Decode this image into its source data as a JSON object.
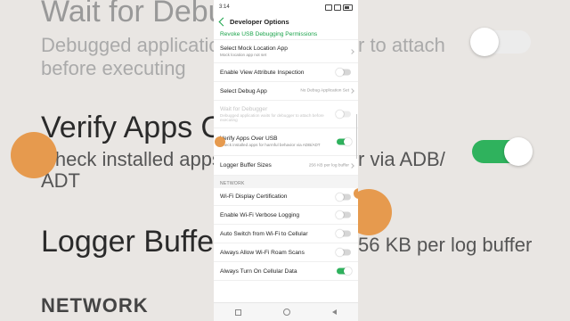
{
  "background": {
    "left": {
      "wait_for_debugger": "Wait for Debugger",
      "debugged_desc_line1": "Debugged application",
      "debugged_desc_line2": "before executing",
      "verify_title": "Verify Apps Over",
      "verify_desc": "Check installed apps",
      "verify_desc2": "ADT",
      "logger_title": "Logger Buffer Si",
      "network": "NETWORK"
    },
    "right": {
      "attach_fragment": "r to attach",
      "adb_fragment": "r via ADB/",
      "buffer_fragment": "56 KB per log buffer"
    }
  },
  "status_bar": {
    "time": "3:14"
  },
  "app_bar": {
    "title": "Developer Options"
  },
  "rows": {
    "revoke": {
      "title": "Revoke USB Debugging Permissions"
    },
    "mock_location": {
      "title": "Select Mock Location App",
      "subtitle": "Mock location app not set"
    },
    "view_attr": {
      "title": "Enable View Attribute Inspection",
      "on": false
    },
    "debug_app": {
      "title": "Select Debug App",
      "value": "No Debug Application Set"
    },
    "wait_debugger": {
      "title": "Wait for Debugger",
      "subtitle": "Debugged application waits for debugger to attach before executing",
      "on": false,
      "disabled": true
    },
    "verify_usb": {
      "title": "Verify Apps Over USB",
      "subtitle": "Check installed apps for harmful behavior via ADB/ADT",
      "on": true
    },
    "logger": {
      "title": "Logger Buffer Sizes",
      "value": "256 KB per log buffer"
    }
  },
  "network_section": {
    "header": "NETWORK"
  },
  "network_rows": {
    "wifi_display": {
      "title": "Wi-Fi Display Certification",
      "on": false
    },
    "wifi_verbose": {
      "title": "Enable Wi-Fi Verbose Logging",
      "on": false
    },
    "auto_switch": {
      "title": "Auto Switch from Wi-Fi to Cellular",
      "on": false
    },
    "roam_scans": {
      "title": "Always Allow Wi-Fi Roam Scans",
      "on": false
    },
    "cellular_data": {
      "title": "Always Turn On Cellular Data",
      "on": true
    }
  },
  "colors": {
    "accent": "#1aa34a",
    "toggle_on": "#2fb25d",
    "fab": "#e69a4e"
  }
}
